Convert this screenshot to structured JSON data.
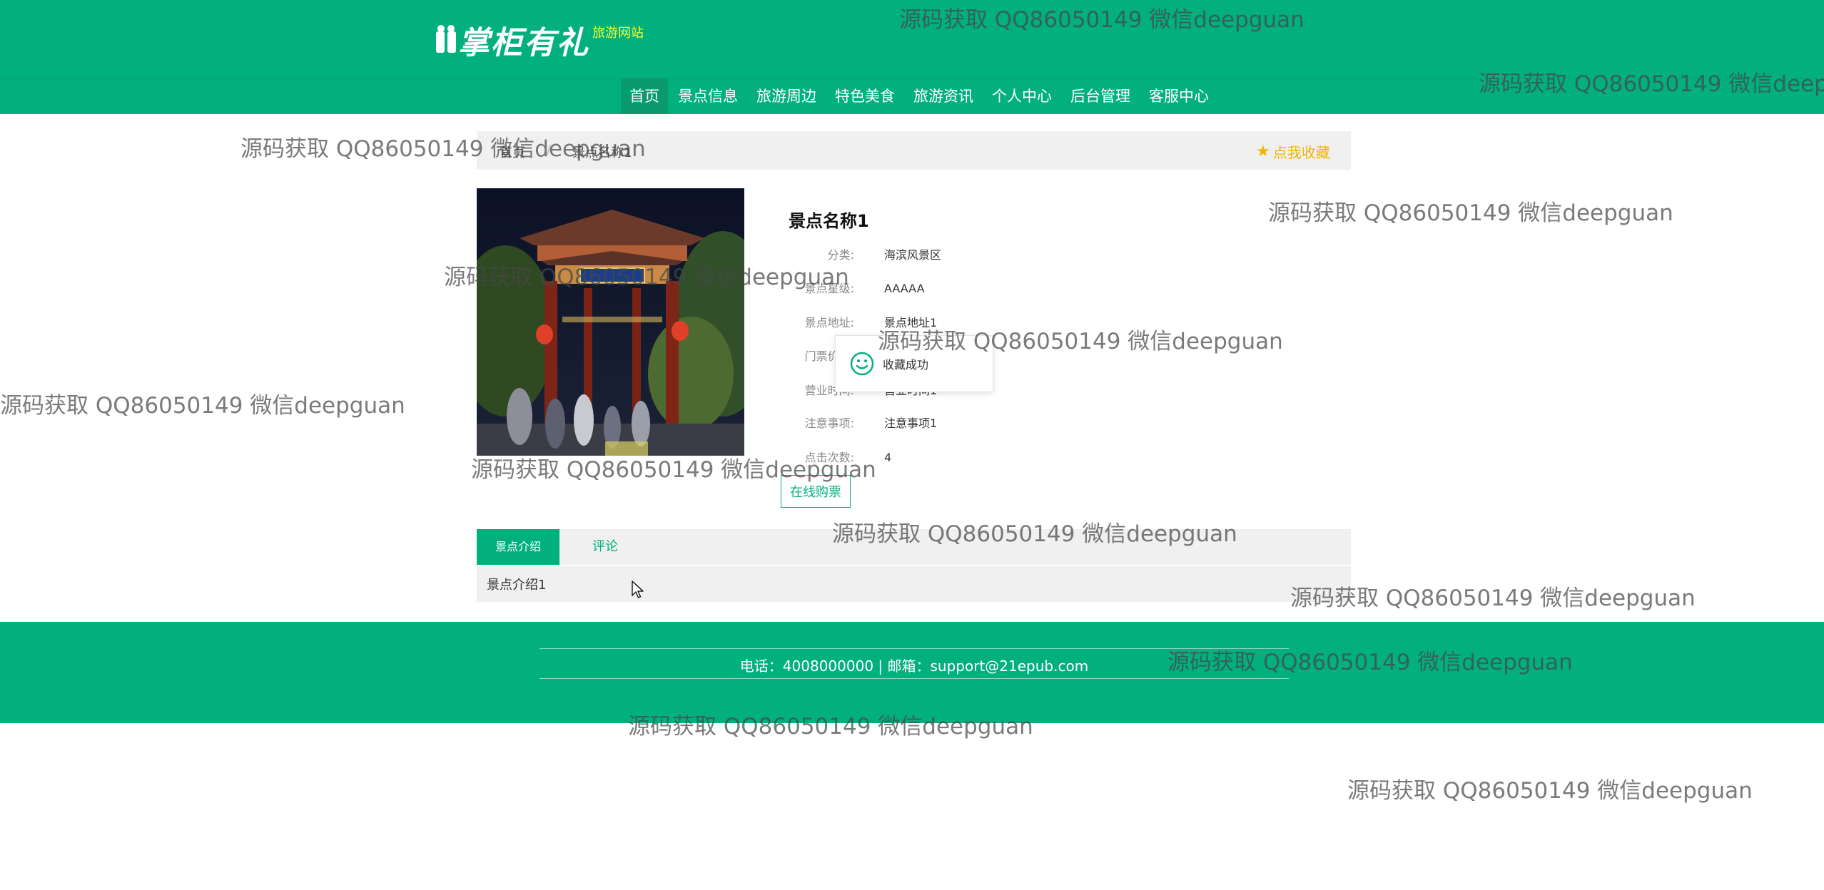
{
  "header": {
    "logo_text": "掌柜有礼",
    "logo_sub": "旅游网站"
  },
  "nav": {
    "items": [
      "首页",
      "景点信息",
      "旅游周边",
      "特色美食",
      "旅游资讯",
      "个人中心",
      "后台管理",
      "客服中心"
    ],
    "active_index": 0
  },
  "breadcrumb": {
    "home": "首页",
    "separator": "/",
    "current": "景点名称1"
  },
  "favorite": {
    "label": "点我收藏",
    "color": "#f1b400"
  },
  "detail": {
    "title": "景点名称1",
    "fields": [
      {
        "label": "分类:",
        "value": "海滨风景区"
      },
      {
        "label": "景点星级:",
        "value": "AAAAA"
      },
      {
        "label": "景点地址:",
        "value": "景点地址1"
      },
      {
        "label": "门票价格:",
        "value": ""
      },
      {
        "label": "营业时间:",
        "value": "营业时间1"
      },
      {
        "label": "注意事项:",
        "value": "注意事项1"
      },
      {
        "label": "点击次数:",
        "value": "4"
      }
    ],
    "buy_button": "在线购票"
  },
  "toast": {
    "text": "收藏成功",
    "icon": "smile-icon"
  },
  "tabs": {
    "items": [
      "景点介绍",
      "评论"
    ],
    "active_index": 0,
    "content": "景点介绍1"
  },
  "footer": {
    "contact": "电话：4008000000 | 邮箱：support@21epub.com"
  },
  "watermark": {
    "text": "源码获取 QQ86050149 微信deepguan",
    "text_cut": "源码获取 QQ86050149 微信deepg"
  },
  "colors": {
    "primary": "#02b07e",
    "nav_active": "#0a9a6e",
    "logo_sub": "#f4ff3a"
  }
}
